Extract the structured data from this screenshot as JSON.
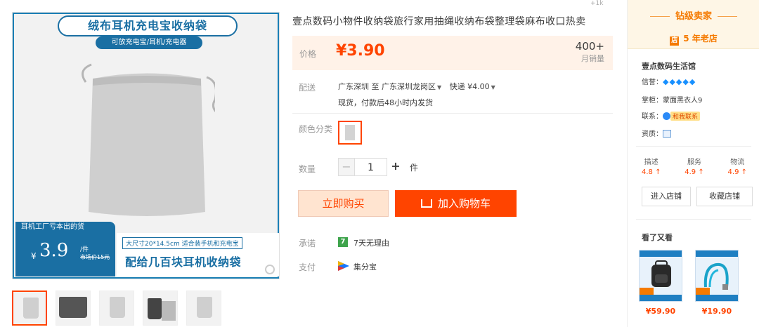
{
  "gallery": {
    "banner_title": "绒布耳机充电宝收纳袋",
    "banner_sub": "可放充电宝/耳机/充电器",
    "promo_tag": "耳机工厂亏本出的货",
    "promo_yen": "¥",
    "promo_price": "3.9",
    "promo_unit": "/件",
    "promo_market": "市场价15元",
    "promo_size": "大尺寸20*14.5cm 适合装手机和充电宝",
    "promo_slogan": "配给几百块耳机收纳袋",
    "thumbnails": [
      "thumb-1",
      "thumb-2",
      "thumb-3",
      "thumb-4",
      "thumb-5"
    ]
  },
  "product": {
    "title": "壹点数码小物件收纳袋旅行家用抽绳收纳布袋整理袋麻布收口热卖",
    "top_count": "+1k",
    "price_label": "价格",
    "price": "¥3.90",
    "sales_count": "400+",
    "sales_label": "月销量",
    "ship_label": "配送",
    "ship_from": "广东深圳",
    "ship_to_word": "至",
    "ship_to": "广东深圳龙岗区",
    "ship_method": "快递 ¥4.00",
    "ship_note": "现货，付款后48小时内发货",
    "color_label": "颜色分类",
    "qty_label": "数量",
    "qty_value": "1",
    "qty_minus": "−",
    "qty_plus": "+",
    "qty_unit": "件",
    "buy_now": "立即购买",
    "add_cart": "加入购物车",
    "promise_label": "承诺",
    "promise_icon_text": "7",
    "promise_text": "7天无理由",
    "pay_label": "支付",
    "pay_text": "集分宝"
  },
  "seller": {
    "level": "钻级卖家",
    "age_icon": "店",
    "age": "5 年老店",
    "shop_name": "壹点数码生活馆",
    "credit_label": "信誉：",
    "credit_diamonds": "💎💎💎💎💎",
    "keeper_label": "掌柜：",
    "keeper": "蒙面黑衣人9",
    "contact_label": "联系：",
    "contact_badge": "和我联系",
    "qual_label": "资质：",
    "scores": [
      {
        "label": "描述",
        "value": "4.8 ↑"
      },
      {
        "label": "服务",
        "value": "4.9 ↑"
      },
      {
        "label": "物流",
        "value": "4.9 ↑"
      }
    ],
    "enter_shop": "进入店铺",
    "fav_shop": "收藏店铺",
    "watch_title": "看了又看",
    "recommendations": [
      {
        "price": "¥59.90"
      },
      {
        "price": "¥19.90"
      }
    ]
  },
  "colors": {
    "accent": "#ff4400",
    "seller_orange": "#f57a00",
    "brand_blue": "#1a6fa3"
  }
}
